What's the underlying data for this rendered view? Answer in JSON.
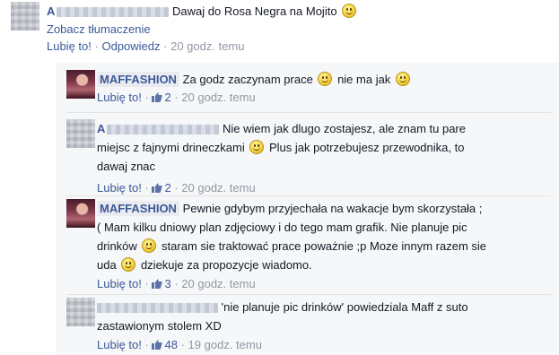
{
  "comments": [
    {
      "author": "A",
      "text_parts": [
        "Dawaj do Rosa Negra na Mojito",
        ""
      ],
      "translate": "Zobacz tłumaczenie",
      "like": "Lubię to!",
      "reply": "Odpowiedz",
      "time": "20 godz. temu"
    },
    {
      "author": "MAFFASHION",
      "text_parts": [
        "Za godz zaczynam prace",
        "nie ma jak",
        ""
      ],
      "like": "Lubię to!",
      "likes": "2",
      "time": "20 godz. temu"
    },
    {
      "author": "A",
      "text_line1": "Nie wiem jak dlugo zostajesz, ale znam tu pare",
      "text_line2a": "miejsc z fajnymi drineczkami",
      "text_line2b": "Plus jak potrzebujesz przewodnika, to",
      "text_line3": "dawaj znac",
      "like": "Lubię to!",
      "likes": "2",
      "time": "20 godz. temu"
    },
    {
      "author": "MAFFASHION",
      "text_line1": "Pewnie gdybym przyjechała na wakacje bym skorzystała ;",
      "text_line2": "( Mam kilku dniowy plan zdjęciowy i do tego mam grafik. Nie planuje pic",
      "text_line3a": "drinków",
      "text_line3b": "staram sie traktować prace poważnie ;p Moze innym razem sie",
      "text_line4a": "uda",
      "text_line4b": "dziekuje za propozycje wiadomo.",
      "like": "Lubię to!",
      "likes": "3",
      "time": "20 godz. temu"
    },
    {
      "author": "",
      "text_line1": "'nie planuje pic drinków' powiedziala Maff z suto",
      "text_line2": "zastawionym stolem XD",
      "like": "Lubię to!",
      "likes": "48",
      "time": "19 godz. temu"
    }
  ],
  "separator": "·",
  "colors": {
    "link": "#3b5998",
    "meta": "#9197a3",
    "panel": "#f6f7f9"
  },
  "icons": {
    "smiley": "smiley-emoticon-icon",
    "like": "thumbs-up-icon"
  }
}
